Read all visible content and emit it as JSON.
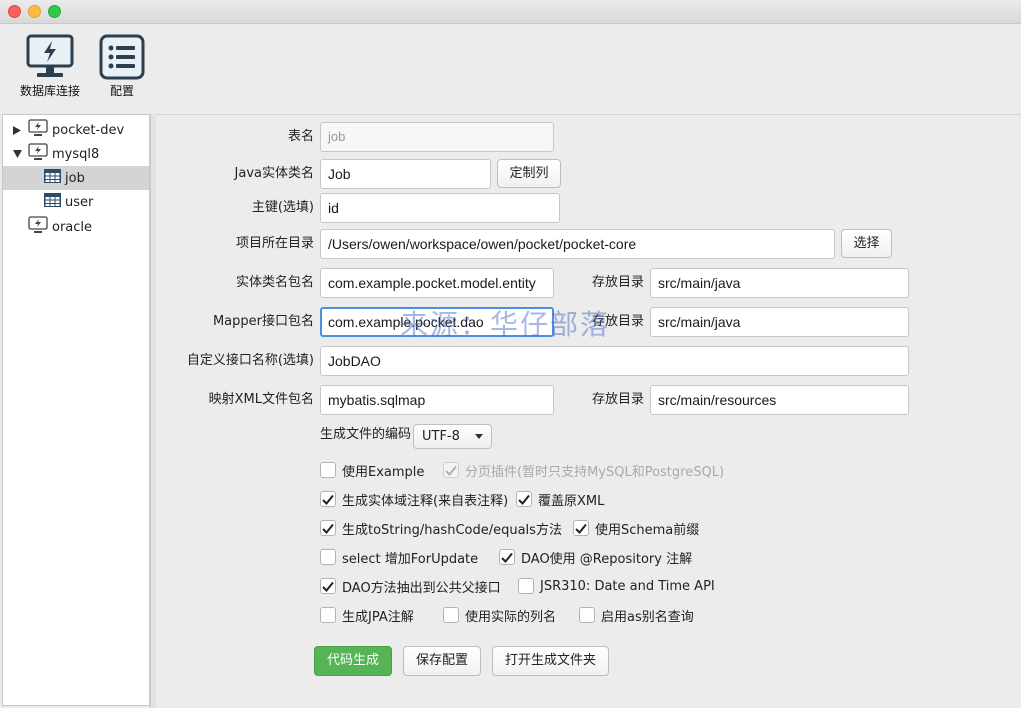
{
  "toolbar": {
    "db_connect_label": "数据库连接",
    "config_label": "配置"
  },
  "sidebar": {
    "items": [
      {
        "label": "pocket-dev",
        "kind": "connection",
        "expanded": false
      },
      {
        "label": "mysql8",
        "kind": "connection",
        "expanded": true
      },
      {
        "label": "job",
        "kind": "table",
        "selected": true
      },
      {
        "label": "user",
        "kind": "table",
        "selected": false
      },
      {
        "label": "oracle",
        "kind": "connection",
        "expanded": false
      }
    ]
  },
  "form": {
    "table_name": {
      "label": "表名",
      "placeholder": "job"
    },
    "entity_class": {
      "label": "Java实体类名",
      "value": "Job",
      "button": "定制列"
    },
    "primary_key": {
      "label": "主键(选填)",
      "value": "id"
    },
    "project_dir": {
      "label": "项目所在目录",
      "value": "/Users/owen/workspace/owen/pocket/pocket-core",
      "button": "选择"
    },
    "entity_package": {
      "label": "实体类名包名",
      "value": "com.example.pocket.model.entity",
      "dir_label": "存放目录",
      "dir_value": "src/main/java"
    },
    "mapper_package": {
      "label": "Mapper接口包名",
      "value": "com.example.pocket.dao",
      "dir_label": "存放目录",
      "dir_value": "src/main/java"
    },
    "custom_interface": {
      "label": "自定义接口名称(选填)",
      "value": "JobDAO"
    },
    "xml_package": {
      "label": "映射XML文件包名",
      "value": "mybatis.sqlmap",
      "dir_label": "存放目录",
      "dir_value": "src/main/resources"
    },
    "encoding": {
      "label": "生成文件的编码",
      "value": "UTF-8"
    }
  },
  "options": [
    {
      "label": "使用Example",
      "checked": false,
      "disabled": false
    },
    {
      "label": "分页插件(暂时只支持MySQL和PostgreSQL)",
      "checked": true,
      "disabled": true
    },
    {
      "label": "生成实体域注释(来自表注释)",
      "checked": true,
      "disabled": false
    },
    {
      "label": "覆盖原XML",
      "checked": true,
      "disabled": false
    },
    {
      "label": "生成toString/hashCode/equals方法",
      "checked": true,
      "disabled": false
    },
    {
      "label": "使用Schema前缀",
      "checked": true,
      "disabled": false
    },
    {
      "label": "select 增加ForUpdate",
      "checked": false,
      "disabled": false
    },
    {
      "label": "DAO使用 @Repository 注解",
      "checked": true,
      "disabled": false
    },
    {
      "label": "DAO方法抽出到公共父接口",
      "checked": true,
      "disabled": false
    },
    {
      "label": "JSR310: Date and Time API",
      "checked": false,
      "disabled": false
    },
    {
      "label": "生成JPA注解",
      "checked": false,
      "disabled": false
    },
    {
      "label": "使用实际的列名",
      "checked": false,
      "disabled": false
    },
    {
      "label": "启用as别名查询",
      "checked": false,
      "disabled": false
    }
  ],
  "actions": {
    "generate": "代码生成",
    "save_config": "保存配置",
    "open_folder": "打开生成文件夹"
  },
  "watermark": "来源：华仔部落",
  "colors": {
    "primary_button": "#55b555",
    "focus_ring": "#4a90e2"
  }
}
